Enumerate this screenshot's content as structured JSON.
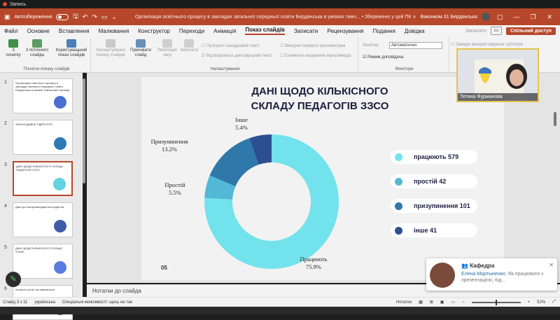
{
  "recording": {
    "label": "Запись"
  },
  "titlebar": {
    "autosave": "Автозбереження",
    "doc_title": "Організація освітнього процесу в закладах загальної середньої освіти Бердянська в умовах тимч... • Збережено у цей ПК ∨",
    "user": "Виконком 31 Бердянська",
    "avatar_initial": "В"
  },
  "menu": {
    "items": [
      "Файл",
      "Основне",
      "Вставлення",
      "Малювання",
      "Конструктор",
      "Переходи",
      "Анімація",
      "Показ слайдів",
      "Записати",
      "Рецензування",
      "Подання",
      "Довідка"
    ],
    "active_index": 7,
    "notes": "Записати",
    "share": "Спільний доступ"
  },
  "ribbon": {
    "btn_from_start": "З початку",
    "btn_from_current": "З поточного слайда",
    "btn_custom": "Користувацький показ слайдів",
    "group_start": "Початок показу слайдів",
    "btn_setup": "Налаштування показу слайдів",
    "btn_hide": "Приховати слайд",
    "btn_rehearse": "Репетиція часу",
    "btn_record": "Записати",
    "chk_narration": "Програти закадровий текст",
    "chk_timings": "Використовувати хронометраж",
    "chk_media": "Відтворювати диктоврський текст",
    "chk_controls": "Елементи керування мультимедіа",
    "group_setup": "Налаштування",
    "monitor_label": "Монітор:",
    "monitor_value": "Автоматично",
    "presenter_view": "Режим доповідача",
    "group_monitors": "Монітори",
    "always_subtitles": "Завжди використовувати субтитри"
  },
  "thumbnails": [
    {
      "num": "1",
      "text": "Організація освітнього процесу в закладах загальної середньої освіти Бердянська в умовах тимчасової окупації"
    },
    {
      "num": "2",
      "text": "ЗАКОНОДАВЧЕ ПІДҐРУНТЯ"
    },
    {
      "num": "3",
      "text": "ДАНІ ЩОДО КІЛЬКІСНОГО СКЛАДУ ПЕДАГОГІВ ЗЗСО"
    },
    {
      "num": "4",
      "text": "Дані про місцезнаходження педагогів"
    },
    {
      "num": "5",
      "text": "ДАНІ ЩОДО КІЛЬКІСНОГО СКЛАДУ УЧНІВ"
    },
    {
      "num": "6",
      "text": "Кількість учнів, які навчаються"
    }
  ],
  "slide": {
    "title": "ДАНІ ЩОДО КІЛЬКІСНОГО СКЛАДУ ПЕДАГОГІВ ЗЗСО",
    "number": "05"
  },
  "chart_data": {
    "type": "pie",
    "title": "ДАНІ ЩОДО КІЛЬКІСНОГО СКЛАДУ ПЕДАГОГІВ ЗЗСО",
    "categories": [
      "Працюють",
      "Простій",
      "Призупинення",
      "Інше"
    ],
    "values": [
      579,
      42,
      101,
      41
    ],
    "percent_labels": [
      "75.9%",
      "5.5%",
      "13.2%",
      "5.4%"
    ],
    "colors": [
      "#72e3ec",
      "#52b8d6",
      "#2f78aa",
      "#2d4f92"
    ],
    "legend": [
      "працюють 579",
      "простій 42",
      "призупинення 101",
      "інше 41"
    ],
    "legend_position": "right",
    "donut": true
  },
  "notes": {
    "placeholder": "Нотатки до слайда"
  },
  "status": {
    "slide_of": "Слайд 3 з 11",
    "language": "українська",
    "accessibility": "Спеціальні можливості: щось не так",
    "notes_btn": "Нотатки",
    "zoom": "52%"
  },
  "webcam": {
    "name": "Тетяна Фурманова"
  },
  "toast": {
    "title": "Кафедра",
    "author": "Елена Мартыненко:",
    "message": "Як працювати з презентацією, під..."
  }
}
